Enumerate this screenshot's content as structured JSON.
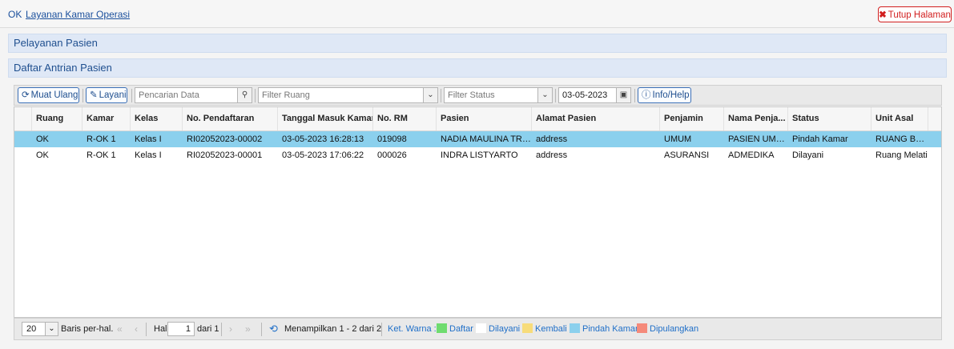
{
  "breadcrumb": {
    "ok": "OK",
    "page": "Layanan Kamar Operasi"
  },
  "close_button": {
    "label": "Tutup Halaman"
  },
  "panels": {
    "pelayanan": "Pelayanan Pasien",
    "antrian": "Daftar Antrian Pasien"
  },
  "toolbar": {
    "reload_label": "Muat Ulang",
    "layani_label": "Layani",
    "search_placeholder": "Pencarian Data",
    "room_filter_placeholder": "Filter Ruang",
    "status_filter_placeholder": "Filter Status",
    "date_value": "03-05-2023",
    "info_label": "Info/Help"
  },
  "table": {
    "headers": [
      "Ruang",
      "Kamar",
      "Kelas",
      "No. Pendaftaran",
      "Tanggal Masuk Kamar",
      "No. RM",
      "Pasien",
      "Alamat Pasien",
      "Penjamin",
      "Nama Penja...",
      "Status",
      "Unit Asal"
    ],
    "rows": [
      {
        "selected": true,
        "cells": [
          "OK",
          "R-OK 1",
          "Kelas I",
          "RI02052023-00002",
          "03-05-2023 16:28:13",
          "019098",
          "NADIA MAULINA TRIS...",
          "address",
          "UMUM",
          "PASIEN UMUM",
          "Pindah Kamar",
          "RUANG BUMI"
        ]
      },
      {
        "selected": false,
        "cells": [
          "OK",
          "R-OK 1",
          "Kelas I",
          "RI02052023-00001",
          "03-05-2023 17:06:22",
          "000026",
          "INDRA LISTYARTO",
          "address",
          "ASURANSI",
          "ADMEDIKA",
          "Dilayani",
          "Ruang Melati"
        ]
      }
    ]
  },
  "pager": {
    "page_size": "20",
    "per_page_label": "Baris per-hal.",
    "page_label": "Hal",
    "page_value": "1",
    "of_label": "dari 1",
    "display_text": "Menampilkan 1 - 2 dari 2",
    "legend_title": "Ket. Warna :",
    "legend": [
      {
        "label": "Daftar",
        "color": "#6fdc6f"
      },
      {
        "label": "Dilayani",
        "color": "#ffffff"
      },
      {
        "label": "Kembali",
        "color": "#f7dc7a"
      },
      {
        "label": "Pindah Kamar",
        "color": "#8bd0ed"
      },
      {
        "label": "Dipulangkan",
        "color": "#f58a7a"
      }
    ]
  }
}
